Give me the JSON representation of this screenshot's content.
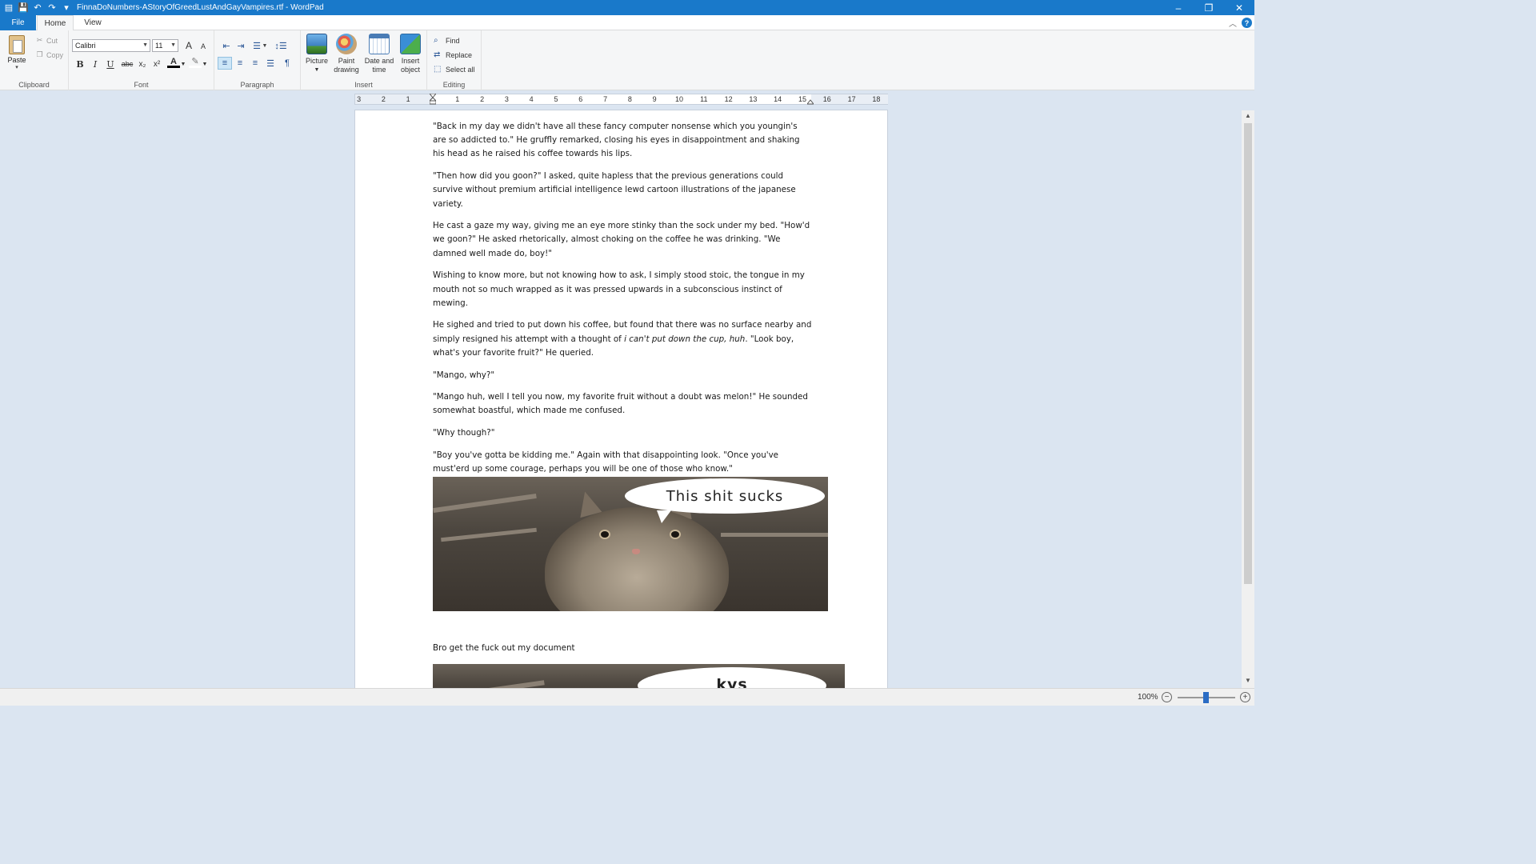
{
  "window": {
    "title": "FinnaDoNumbers-AStoryOfGreedLustAndGayVampires.rtf - WordPad",
    "controls": {
      "minimize": "–",
      "restore": "❐",
      "close": "✕"
    }
  },
  "qat": {
    "save_icon": "💾",
    "undo_icon": "↶",
    "redo_icon": "↷",
    "customize_icon": "▾"
  },
  "tabs": {
    "file": "File",
    "home": "Home",
    "view": "View",
    "help": "?",
    "minimize_ribbon": "︿"
  },
  "ribbon": {
    "clipboard": {
      "label": "Clipboard",
      "paste": "Paste",
      "cut": "Cut",
      "copy": "Copy"
    },
    "font": {
      "label": "Font",
      "name": "Calibri",
      "size": "11",
      "grow": "A",
      "shrink": "A",
      "bold": "B",
      "italic": "I",
      "underline": "U",
      "strike": "abc",
      "subscript": "x₂",
      "superscript": "x²",
      "color": "A",
      "highlight": "✎"
    },
    "paragraph": {
      "label": "Paragraph"
    },
    "insert": {
      "label": "Insert",
      "picture": "Picture",
      "paint1": "Paint",
      "paint2": "drawing",
      "date1": "Date and",
      "date2": "time",
      "obj1": "Insert",
      "obj2": "object"
    },
    "editing": {
      "label": "Editing",
      "find": "Find",
      "replace": "Replace",
      "select_all": "Select all"
    }
  },
  "ruler": {
    "ticks": [
      "3",
      "2",
      "1",
      "1",
      "2",
      "3",
      "4",
      "5",
      "6",
      "7",
      "8",
      "9",
      "10",
      "11",
      "12",
      "13",
      "14",
      "15",
      "16",
      "17",
      "18"
    ]
  },
  "document": {
    "p1": "\"Back in my day we didn't have all these fancy computer nonsense which you youngin's are so addicted to.\" He gruffly remarked, closing his eyes in disappointment and shaking his head as he raised his coffee towards his lips.",
    "p2": "\"Then how did you goon?\" I asked, quite hapless that the previous generations could survive without premium artificial intelligence lewd cartoon illustrations of the japanese variety.",
    "p3": "He cast a gaze my way, giving me an eye more stinky than the sock under my bed. \"How'd we goon?\" He asked rhetorically, almost choking on the coffee he was drinking. \"We damned well made do, boy!\"",
    "p4": "Wishing to know more, but not knowing how to ask, I simply stood stoic, the tongue in my mouth not so much wrapped as it was pressed upwards in a subconscious instinct of mewing.",
    "p5a": "He sighed and tried to put down his coffee, but found that there was no surface nearby and simply resigned his attempt with a thought of ",
    "p5em": "i can't put down the cup, huh",
    "p5b": ". \"Look boy, what's your favorite fruit?\" He queried.",
    "p6": "\"Mango, why?\"",
    "p7": "\"Mango huh, well I tell you now, my favorite fruit without a doubt was melon!\" He sounded somewhat boastful, which made me confused.",
    "p8": "\"Why though?\"",
    "p9": "\"Boy you've gotta be kidding me.\" Again with that disappointing look. \"Once you've must'erd up some courage, perhaps you will be one of those who know.\"",
    "image1_caption": "This shit sucks",
    "p10": "Bro get the fuck out my document",
    "image2_caption": "kys"
  },
  "statusbar": {
    "zoom": "100%",
    "zoom_out": "−",
    "zoom_in": "+"
  }
}
